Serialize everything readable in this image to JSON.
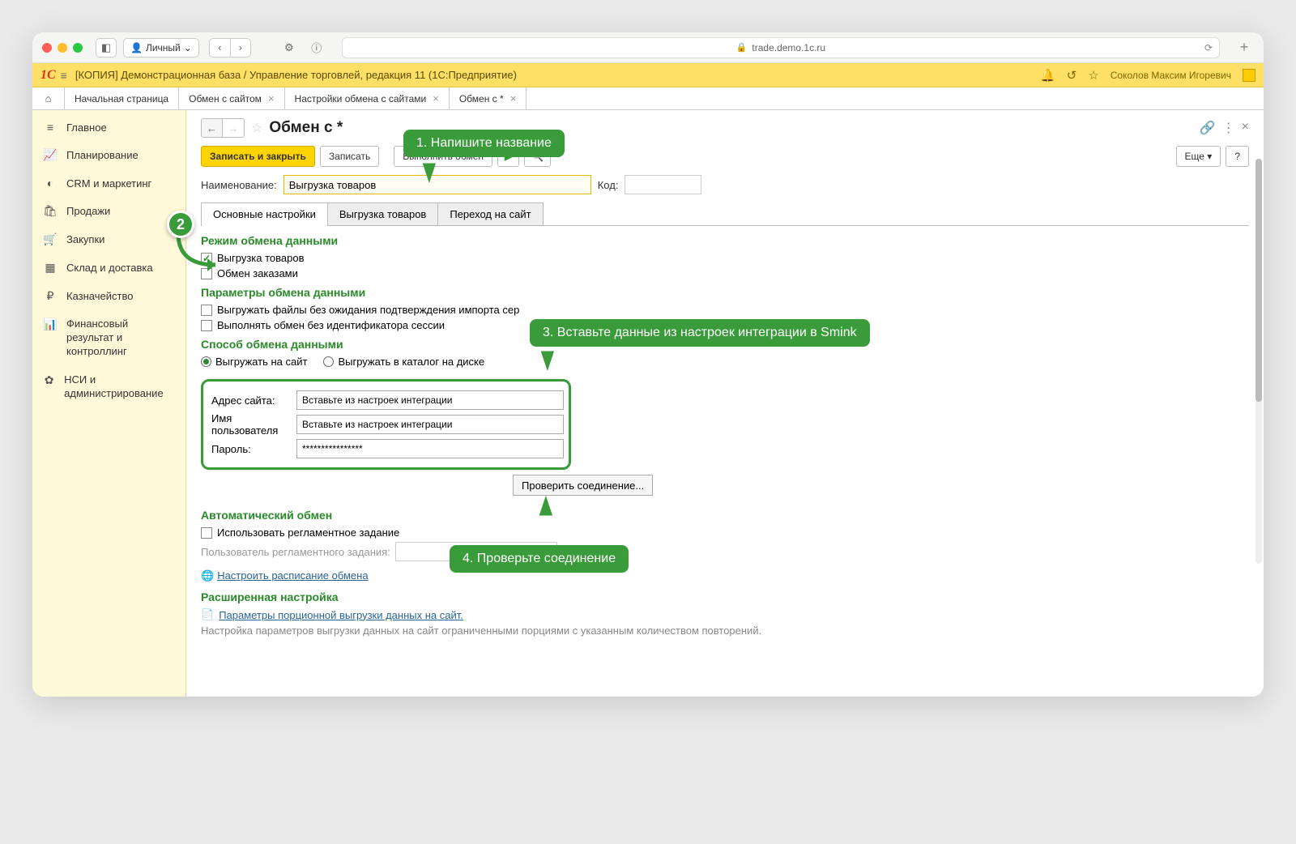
{
  "browser": {
    "profile": "Личный",
    "url_host": "trade.demo.1c.ru"
  },
  "header": {
    "title": "[КОПИЯ] Демонстрационная база / Управление торговлей, редакция 11  (1С:Предприятие)",
    "user": "Соколов Максим Игоревич"
  },
  "tabs": {
    "home": "Начальная страница",
    "t1": "Обмен с сайтом",
    "t2": "Настройки обмена с сайтами",
    "t3": "Обмен с *"
  },
  "sidebar": {
    "items": [
      {
        "icon": "≡",
        "label": "Главное"
      },
      {
        "icon": "📈",
        "label": "Планирование"
      },
      {
        "icon": "◐",
        "label": "CRM и маркетинг"
      },
      {
        "icon": "🛍",
        "label": "Продажи"
      },
      {
        "icon": "🛒",
        "label": "Закупки"
      },
      {
        "icon": "▦",
        "label": "Склад и доставка"
      },
      {
        "icon": "₽",
        "label": "Казначейство"
      },
      {
        "icon": "📊",
        "label": "Финансовый результат и контроллинг"
      },
      {
        "icon": "✿",
        "label": "НСИ и администрирование"
      }
    ]
  },
  "page": {
    "title": "Обмен с *",
    "toolbar": {
      "save_close": "Записать и закрыть",
      "save": "Записать",
      "do_exchange": "Выполнить обмен",
      "more": "Еще",
      "help": "?"
    },
    "name_label": "Наименование:",
    "name_value": "Выгрузка товаров",
    "code_label": "Код:",
    "inner_tabs": {
      "t1": "Основные настройки",
      "t2": "Выгрузка товаров",
      "t3": "Переход на сайт"
    },
    "sections": {
      "mode": {
        "title": "Режим обмена данными",
        "opt1": "Выгрузка товаров",
        "opt2": "Обмен заказами"
      },
      "params": {
        "title": "Параметры обмена данными",
        "opt1": "Выгружать файлы без ожидания подтверждения импорта сер",
        "opt2": "Выполнять обмен без идентификатора сессии"
      },
      "method": {
        "title": "Способ обмена данными",
        "r1": "Выгружать на сайт",
        "r2": "Выгружать в каталог на диске",
        "addr_label": "Адрес сайта:",
        "addr_value": "Вставьте из настроек интеграции",
        "user_label": "Имя пользователя",
        "user_value": "Вставьте из настроек интеграции",
        "pass_label": "Пароль:",
        "pass_value": "****************",
        "check_btn": "Проверить соединение..."
      },
      "auto": {
        "title": "Автоматический обмен",
        "opt1": "Использовать регламентное задание",
        "user_label": "Пользователь регламентного задания:",
        "schedule_link": "Настроить расписание обмена"
      },
      "advanced": {
        "title": "Расширенная настройка",
        "link": "Параметры порционной выгрузки данных на сайт.",
        "desc": "Настройка параметров выгрузки данных на сайт ограниченными порциями с указанным количеством повторений."
      }
    }
  },
  "callouts": {
    "c1": "1. Напишите название",
    "c2": "2",
    "c3": "3. Вставьте данные из настроек интеграции в Smink",
    "c4": "4. Проверьте соединение"
  }
}
